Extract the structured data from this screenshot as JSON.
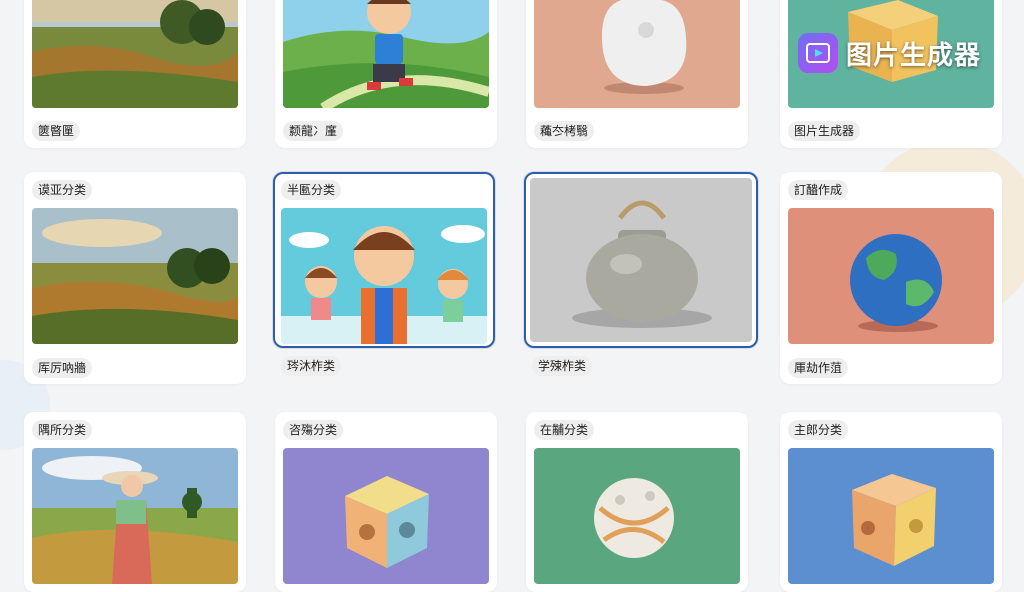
{
  "brand": {
    "title": "图片生成器",
    "icon": "image-generator-logo-icon"
  },
  "rows": [
    {
      "cards": [
        {
          "label": "篋暋匰",
          "image": "landscape-painting",
          "selected": false
        },
        {
          "label": "颣龍冫廑",
          "image": "cartoon-boy-running",
          "selected": false
        },
        {
          "label": "蘒冭栲翳",
          "image": "clay-blob",
          "selected": false
        },
        {
          "label": "图片生成器",
          "image": "clay-cube-teal",
          "selected": false
        }
      ]
    },
    {
      "cards": [
        {
          "top_label": "谟亚分类",
          "label": "厍厉吶牆",
          "image": "landscape-painting",
          "selected": false
        },
        {
          "top_label": "半匭分类",
          "label": "琌沐柞类",
          "image": "cartoon-kids",
          "selected": true
        },
        {
          "top_label": "",
          "label": "学殐柞类",
          "image": "ceramic-pot",
          "selected": true
        },
        {
          "top_label": "訂醠作成",
          "label": "厙劫作菹",
          "image": "clay-globe",
          "selected": false
        }
      ]
    },
    {
      "cards": [
        {
          "top_label": "隅所分类",
          "label": "",
          "image": "woman-in-field",
          "selected": false
        },
        {
          "top_label": "咨殤分类",
          "label": "",
          "image": "clay-cube-purple",
          "selected": false
        },
        {
          "top_label": "在黼分类",
          "label": "",
          "image": "clay-ball-green",
          "selected": false
        },
        {
          "top_label": "主郎分类",
          "label": "",
          "image": "clay-cube-blue",
          "selected": false
        }
      ]
    }
  ]
}
